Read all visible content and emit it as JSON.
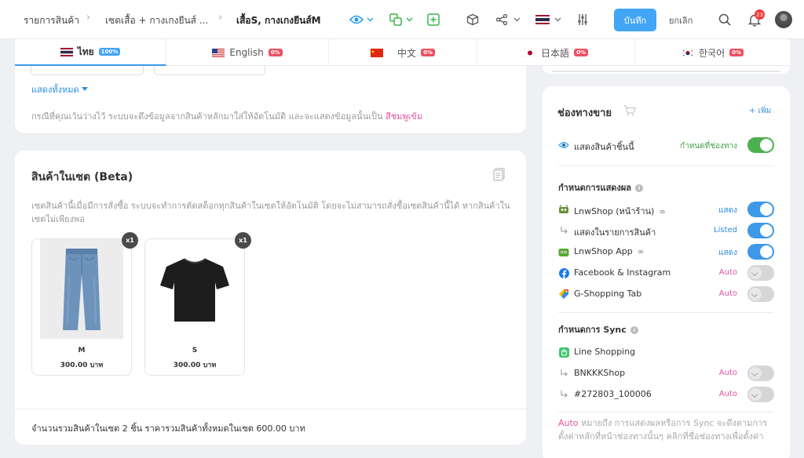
{
  "breadcrumb": {
    "items": [
      "รายการสินค้า",
      "เซตเสื้อ + กางเกงยีนส์ ...",
      "เสื้อS, กางเกงยีนส์M"
    ]
  },
  "toolbar": {
    "save_label": "บันทึก",
    "cancel_label": "ยกเลิก",
    "notification_count": "23",
    "accent_color": "#42a5f5"
  },
  "language_tabs": [
    {
      "label": "ไทย",
      "percent": "100%",
      "flag": "th"
    },
    {
      "label": "English",
      "percent": "0%",
      "flag": "us"
    },
    {
      "label": "中文",
      "percent": "0%",
      "flag": "cn"
    },
    {
      "label": "日本語",
      "percent": "0%",
      "flag": "jp"
    },
    {
      "label": "한국어",
      "percent": "0%",
      "flag": "kr"
    }
  ],
  "description_section": {
    "show_all_label": "แสดงทั้งหมด",
    "hint_text": "กรณีที่คุณเว้นว่างไว้ ระบบจะดึงข้อมูลจากสินค้าหลักมาใส่ให้อัตโนมัติ และจะแสดงข้อมูลนั้นเป็น",
    "hint_highlight": "สีชมพูเข้ม"
  },
  "set_products": {
    "title": "สินค้าในเซต (Beta)",
    "description": "เซตสินค้านี้เมื่อมีการสั่งซื้อ ระบบจะทำการตัดสต็อกทุกสินค้าในเซตให้อัตโนมัติ โดยจะไม่สามารถสั่งซื้อเซตสินค้านี้ได้ หากสินค้าในเซตไม่เพียงพอ",
    "items": [
      {
        "size": "M",
        "price": "300.00 บาท",
        "qty": "x1",
        "image": "jeans"
      },
      {
        "size": "S",
        "price": "300.00 บาท",
        "qty": "x1",
        "image": "black-tshirt"
      }
    ],
    "summary": "จำนวนรวมสินค้าในเซต 2 ชิ้น ราคารวมสินค้าทั้งหมดในเซต 600.00 บาท"
  },
  "channels": {
    "title": "ช่องทางขาย",
    "add_label": "+ เพิ่ม",
    "show_product": {
      "label": "แสดงสินค้าชิ้นนี้",
      "value": "กำหนดที่ช่องทาง"
    },
    "display_section_title": "กำหนดการแสดงผล",
    "display_rows": [
      {
        "label": "LnwShop (หน้าร้าน)",
        "value": "แสดง",
        "state": "on"
      },
      {
        "label": "แสดงในรายการสินค้า",
        "value": "Listed",
        "state": "on"
      },
      {
        "label": "LnwShop App",
        "value": "แสดง",
        "state": "on"
      },
      {
        "label": "Facebook & Instagram",
        "value": "Auto",
        "state": "auto"
      },
      {
        "label": "G-Shopping Tab",
        "value": "Auto",
        "state": "auto"
      }
    ],
    "sync_section_title": "กำหนดการ Sync",
    "sync_rows": [
      {
        "label": "Line Shopping"
      },
      {
        "label": "BNKKKShop",
        "value": "Auto",
        "state": "auto"
      },
      {
        "label": "#272803_100006",
        "value": "Auto",
        "state": "auto"
      }
    ],
    "note_highlight": "Auto",
    "note_text": " หมายถึง การแสดงผลหรือการ Sync จะดึงตามการตั้งค่าหลักที่หน้าช่องทางนั้นๆ คลิกที่ชื่อช่องทางเพื่อตั้งค่า"
  }
}
